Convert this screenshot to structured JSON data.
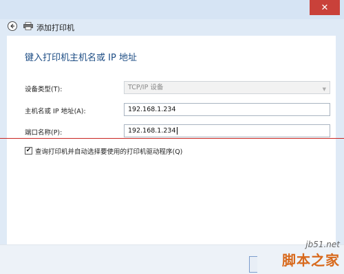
{
  "window": {
    "close_glyph": "✕"
  },
  "header": {
    "title": "添加打印机",
    "back_icon": "back-arrow-icon",
    "printer_icon": "printer-icon"
  },
  "main": {
    "heading": "键入打印机主机名或 IP 地址",
    "device_type": {
      "label": "设备类型(T):",
      "value": "TCP/IP 设备"
    },
    "hostname": {
      "label": "主机名或 IP 地址(A):",
      "value": "192.168.1.234"
    },
    "port_name": {
      "label": "端口名称(P):",
      "value": "192.168.1.234"
    },
    "query_checkbox": {
      "label": "查询打印机并自动选择要使用的打印机驱动程序(Q)",
      "checked": true,
      "glyph": "✔"
    }
  },
  "watermark": {
    "url": "jb51.net",
    "brand": "脚本之家"
  },
  "colors": {
    "heading": "#1c4c84",
    "close": "#c9413a",
    "red_line": "#c8221e",
    "background": "#dfeaf6"
  }
}
